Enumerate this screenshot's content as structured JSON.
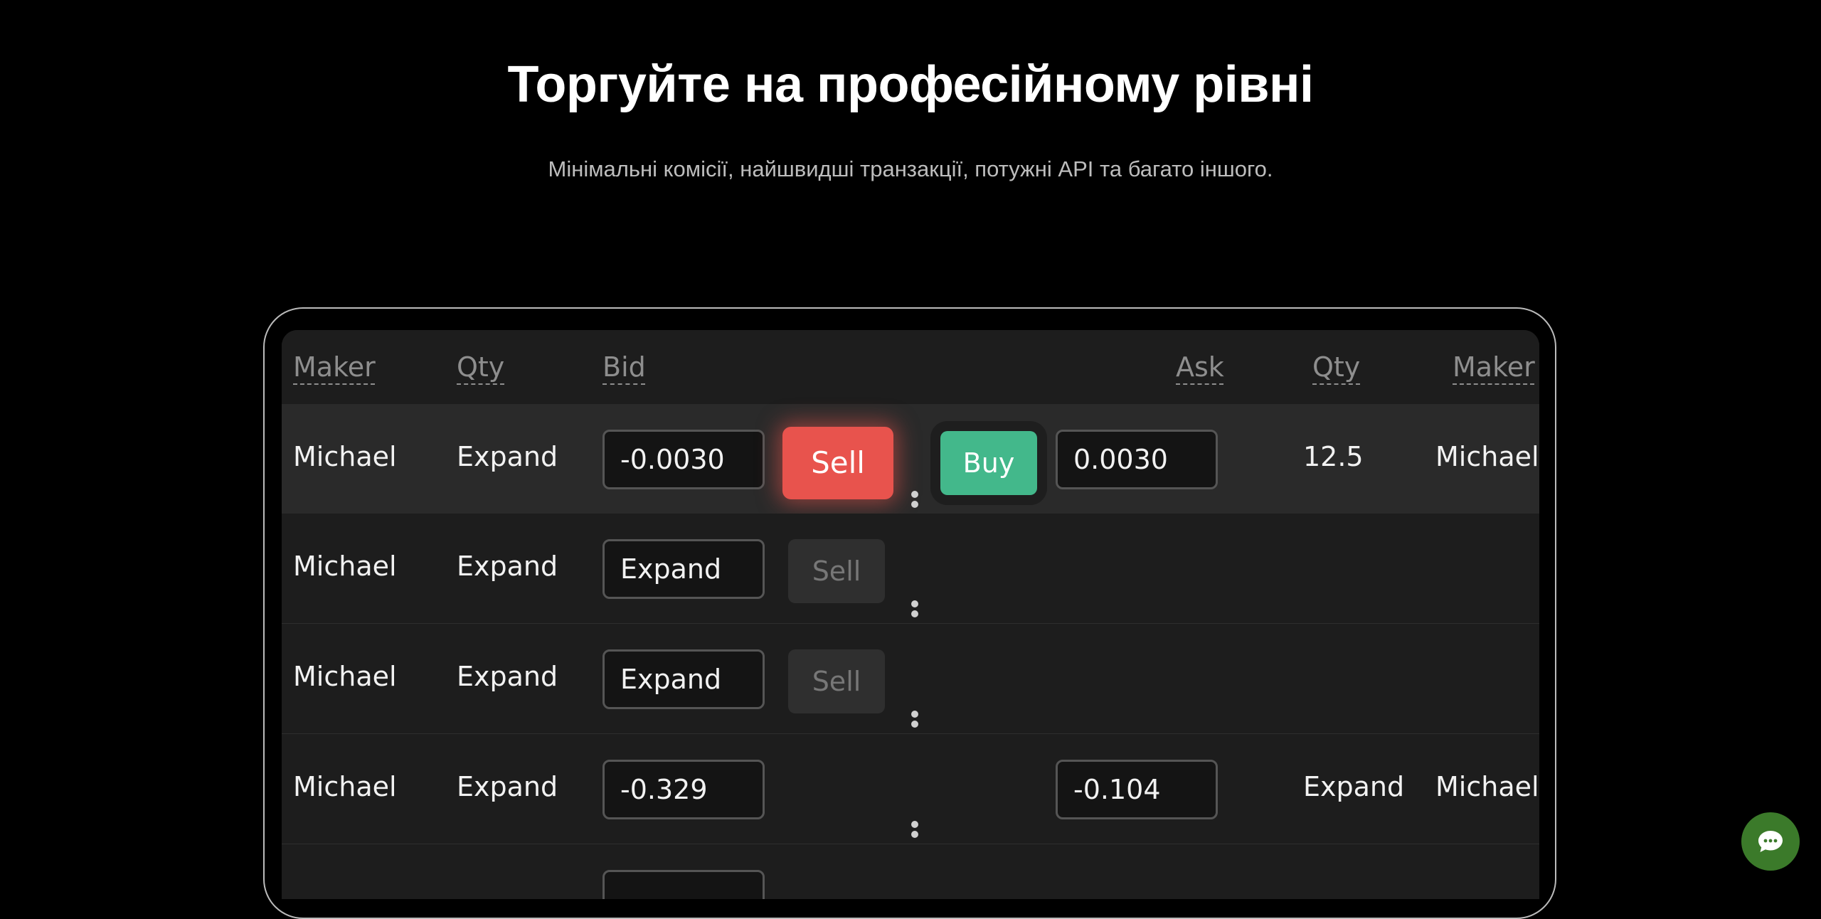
{
  "hero": {
    "title": "Торгуйте на професійному рівні",
    "subtitle": "Мінімальні комісії, найшвидші транзакції, потужні API та багато іншого."
  },
  "table": {
    "headers": {
      "maker_left": "Maker",
      "qty_left": "Qty",
      "bid": "Bid",
      "ask": "Ask",
      "qty_right": "Qty",
      "maker_right": "Maker"
    },
    "rows": [
      {
        "maker_left": "Michael",
        "qty_left": "Expand",
        "bid": "-0.0030",
        "sell_label": "Sell",
        "buy_label": "Buy",
        "ask": "0.0030",
        "qty_right": "12.5",
        "maker_right": "Michael"
      },
      {
        "maker_left": "Michael",
        "qty_left": "Expand",
        "bid": "Expand",
        "sell_label": "Sell"
      },
      {
        "maker_left": "Michael",
        "qty_left": "Expand",
        "bid": "Expand",
        "sell_label": "Sell"
      },
      {
        "maker_left": "Michael",
        "qty_left": "Expand",
        "bid": "-0.329",
        "ask": "-0.104",
        "qty_right": "Expand",
        "maker_right": "Michael"
      }
    ]
  },
  "colors": {
    "sell": "#e8534d",
    "buy": "#43b88b",
    "chat": "#3b7a2a"
  },
  "icons": {
    "chat": "chat-bubble-icon",
    "row_menu": "kebab-menu-icon"
  }
}
